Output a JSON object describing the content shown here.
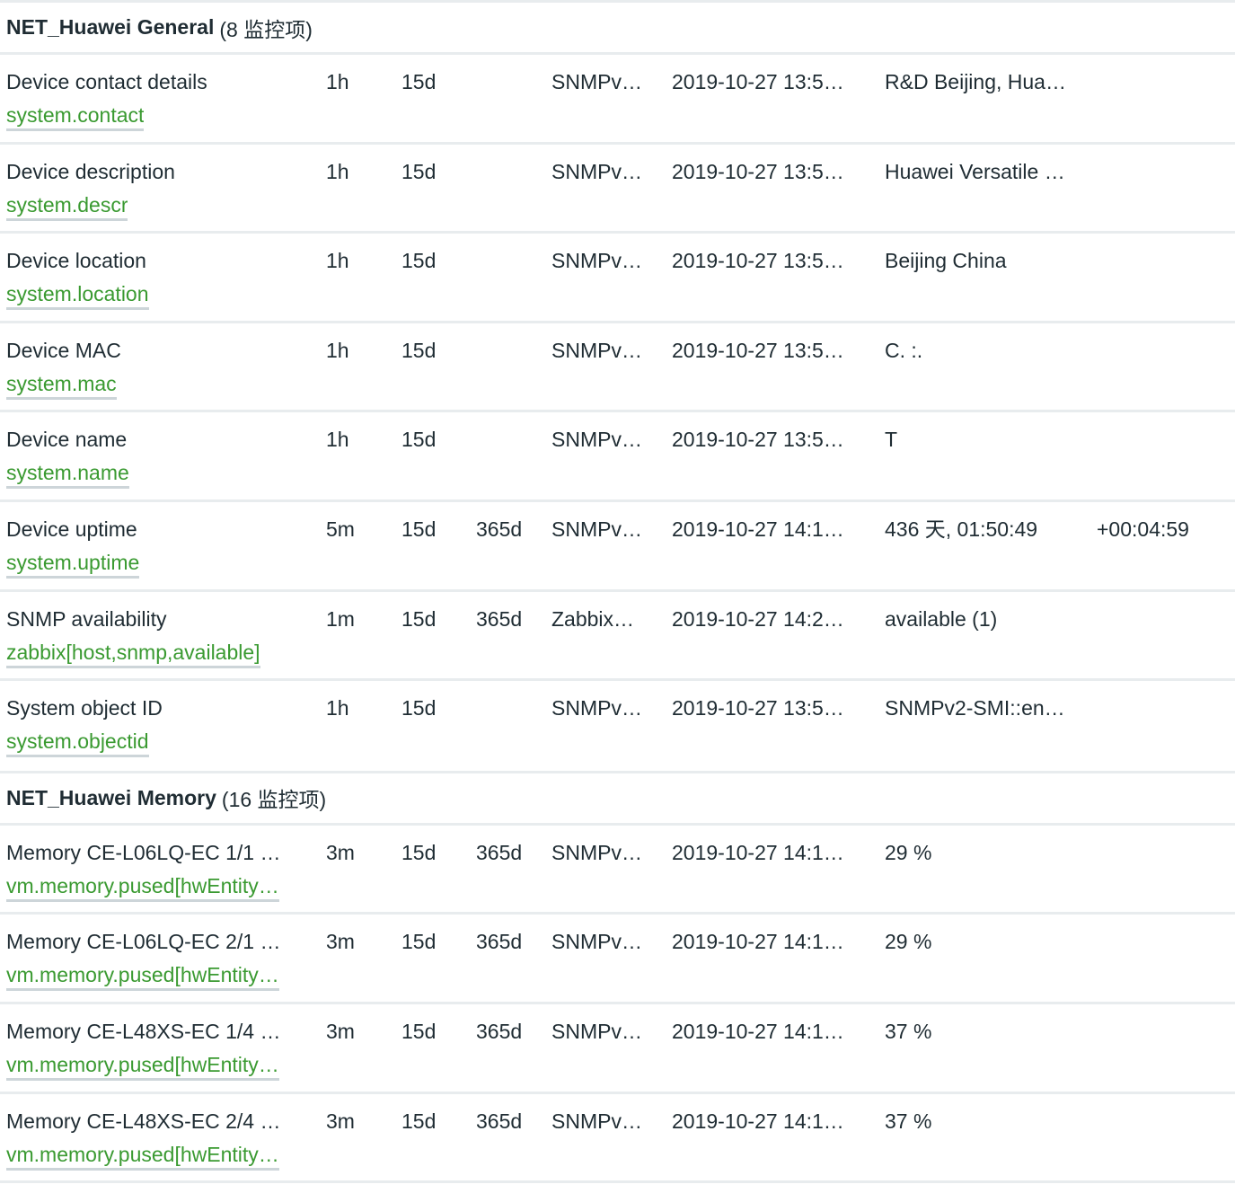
{
  "groups": [
    {
      "name": "NET_Huawei General",
      "count": "(8 监控项)",
      "items": [
        {
          "name": "Device contact details",
          "key": "system.contact",
          "interval": "1h",
          "history": "15d",
          "trends": "",
          "type": "SNMPv…",
          "last_check": "2019-10-27 13:5…",
          "last_value": "R&D Beijing, Hua…",
          "change": ""
        },
        {
          "name": "Device description",
          "key": "system.descr",
          "interval": "1h",
          "history": "15d",
          "trends": "",
          "type": "SNMPv…",
          "last_check": "2019-10-27 13:5…",
          "last_value": "Huawei Versatile …",
          "change": ""
        },
        {
          "name": "Device location",
          "key": "system.location",
          "interval": "1h",
          "history": "15d",
          "trends": "",
          "type": "SNMPv…",
          "last_check": "2019-10-27 13:5…",
          "last_value": "Beijing China",
          "change": ""
        },
        {
          "name": "Device MAC",
          "key": "system.mac",
          "interval": "1h",
          "history": "15d",
          "trends": "",
          "type": "SNMPv…",
          "last_check": "2019-10-27 13:5…",
          "last_value": "C. :.",
          "change": ""
        },
        {
          "name": "Device name",
          "key": "system.name",
          "interval": "1h",
          "history": "15d",
          "trends": "",
          "type": "SNMPv…",
          "last_check": "2019-10-27 13:5…",
          "last_value": "T",
          "change": ""
        },
        {
          "name": "Device uptime",
          "key": "system.uptime",
          "interval": "5m",
          "history": "15d",
          "trends": "365d",
          "type": "SNMPv…",
          "last_check": "2019-10-27 14:1…",
          "last_value": "436 天, 01:50:49",
          "change": "+00:04:59"
        },
        {
          "name": "SNMP availability",
          "key": "zabbix[host,snmp,available]",
          "interval": "1m",
          "history": "15d",
          "trends": "365d",
          "type": "Zabbix…",
          "last_check": "2019-10-27 14:2…",
          "last_value": "available (1)",
          "change": ""
        },
        {
          "name": "System object ID",
          "key": "system.objectid",
          "interval": "1h",
          "history": "15d",
          "trends": "",
          "type": "SNMPv…",
          "last_check": "2019-10-27 13:5…",
          "last_value": "SNMPv2-SMI::en…",
          "change": ""
        }
      ]
    },
    {
      "name": "NET_Huawei Memory",
      "count": "(16 监控项)",
      "items": [
        {
          "name": "Memory CE-L06LQ-EC 1/1 …",
          "key": "vm.memory.pused[hwEntity…",
          "interval": "3m",
          "history": "15d",
          "trends": "365d",
          "type": "SNMPv…",
          "last_check": "2019-10-27 14:1…",
          "last_value": "29 %",
          "change": ""
        },
        {
          "name": "Memory CE-L06LQ-EC 2/1 …",
          "key": "vm.memory.pused[hwEntity…",
          "interval": "3m",
          "history": "15d",
          "trends": "365d",
          "type": "SNMPv…",
          "last_check": "2019-10-27 14:1…",
          "last_value": "29 %",
          "change": ""
        },
        {
          "name": "Memory CE-L48XS-EC 1/4 …",
          "key": "vm.memory.pused[hwEntity…",
          "interval": "3m",
          "history": "15d",
          "trends": "365d",
          "type": "SNMPv…",
          "last_check": "2019-10-27 14:1…",
          "last_value": "37 %",
          "change": ""
        },
        {
          "name": "Memory CE-L48XS-EC 2/4 …",
          "key": "vm.memory.pused[hwEntity…",
          "interval": "3m",
          "history": "15d",
          "trends": "365d",
          "type": "SNMPv…",
          "last_check": "2019-10-27 14:1…",
          "last_value": "37 %",
          "change": ""
        }
      ]
    }
  ]
}
